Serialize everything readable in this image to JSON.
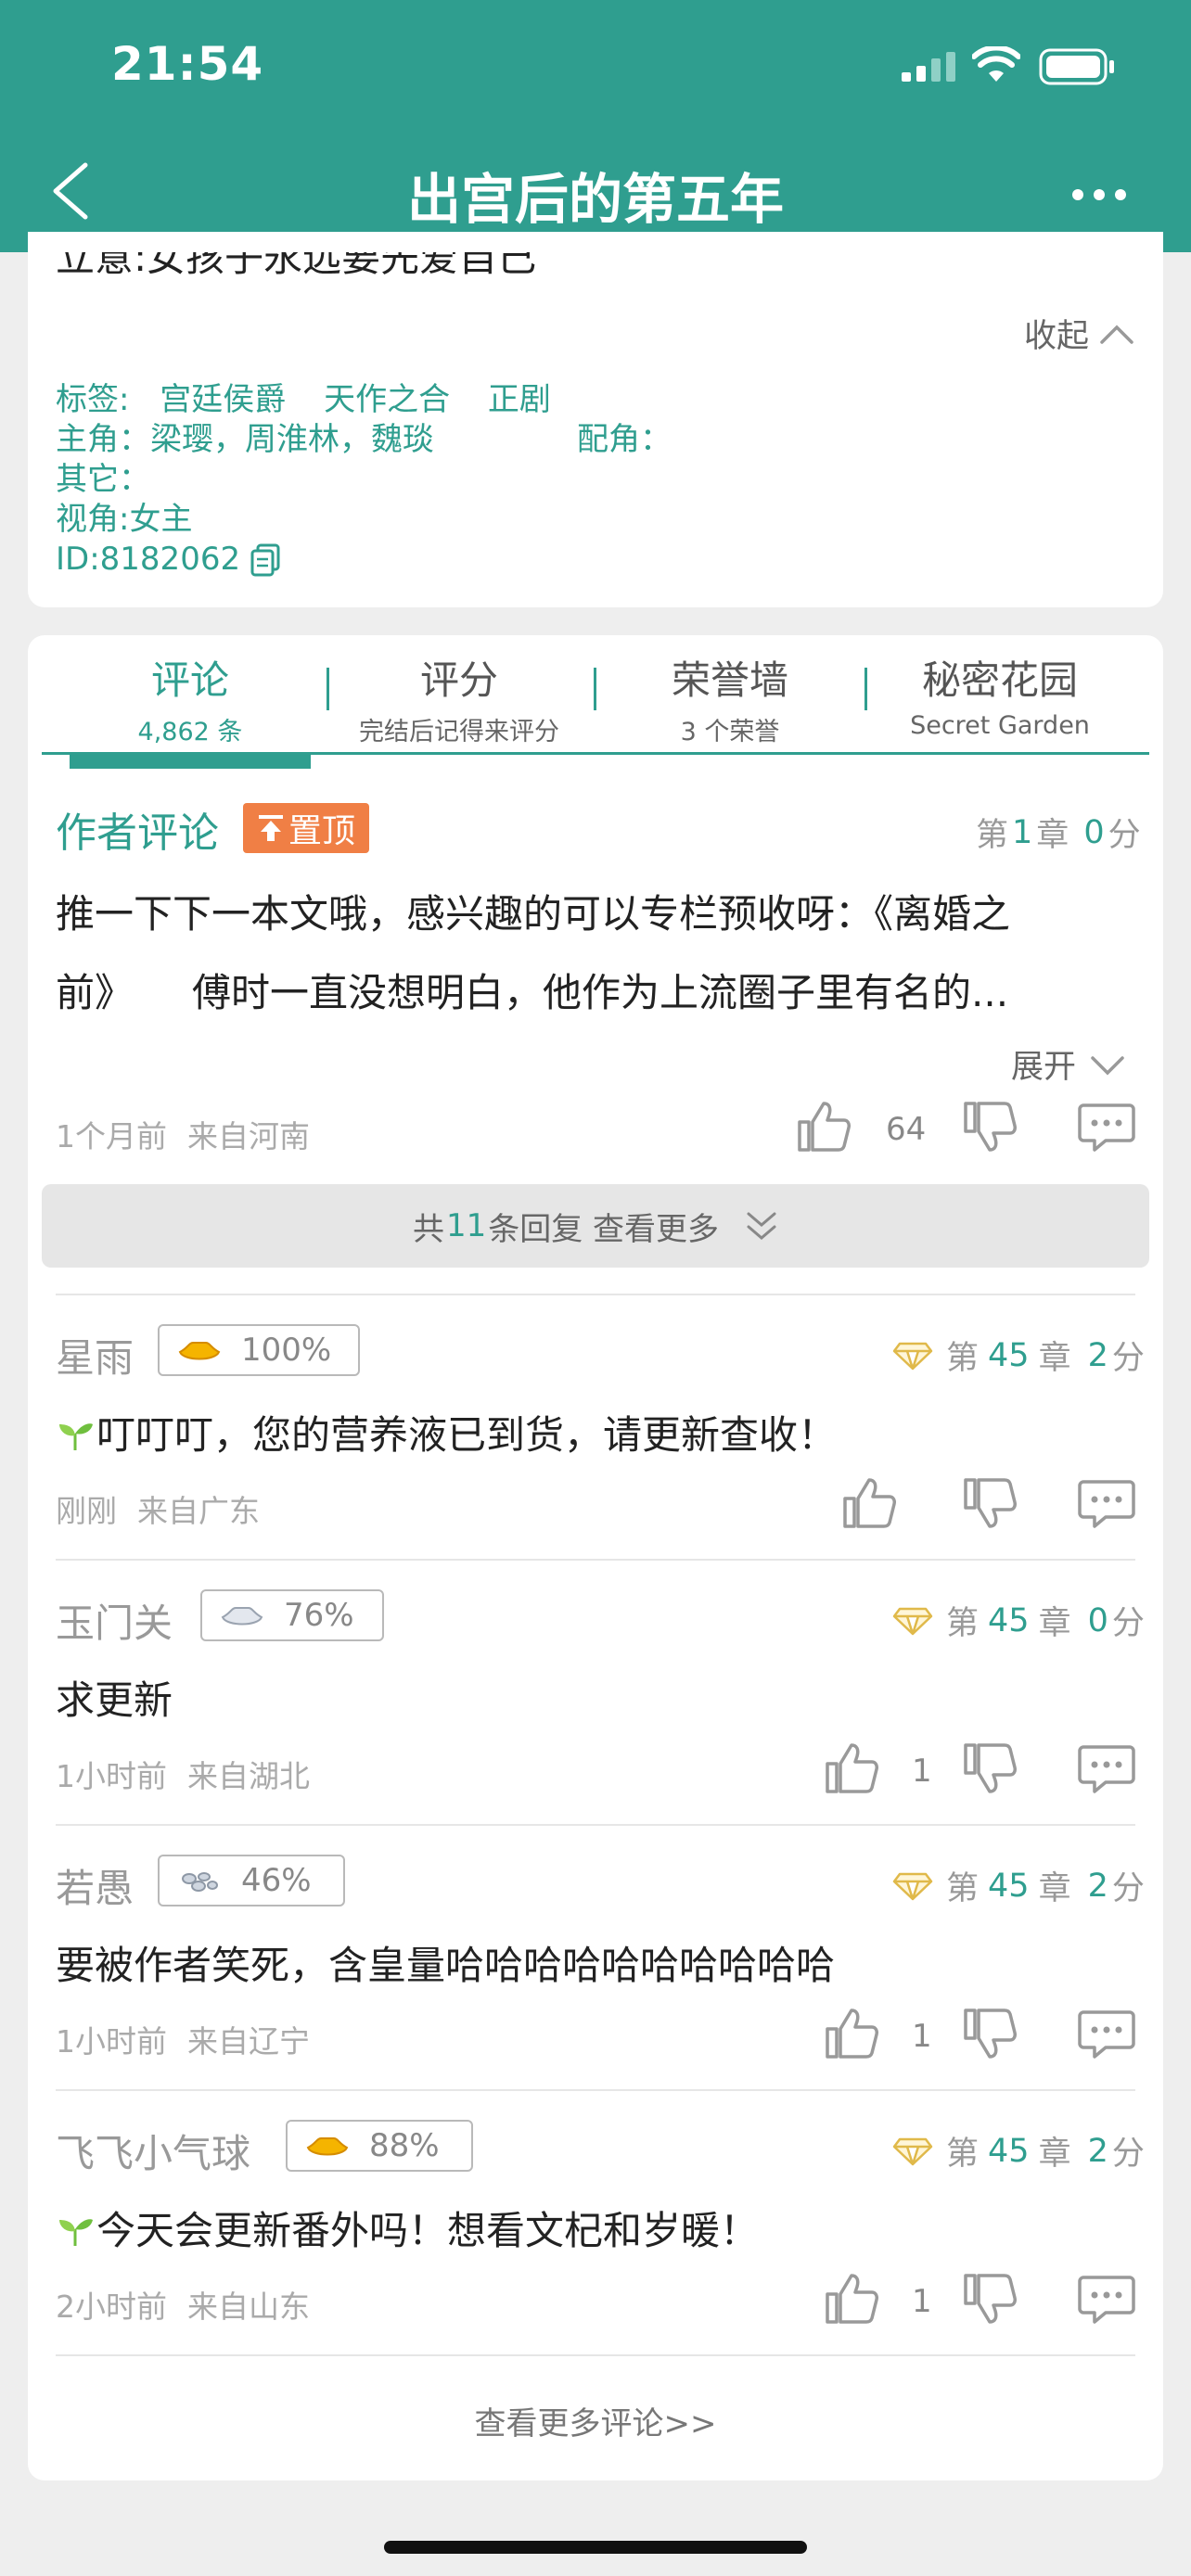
{
  "status_bar": {
    "time": "21:54"
  },
  "nav": {
    "title": "出宫后的第五年"
  },
  "info": {
    "partial_line": "立意:女孩子永远要先爱自己",
    "collapse_label": "收起",
    "tags_label": "标签:",
    "tags": [
      "宫廷侯爵",
      "天作之合",
      "正剧"
    ],
    "leads": "主角：梁璎，周淮林，魏琰",
    "supporting": "配角：",
    "others": "其它：",
    "perspective": "视角:女主",
    "id": "ID:8182062"
  },
  "tabs": [
    {
      "label": "评论",
      "sub": "4,862 条"
    },
    {
      "label": "评分",
      "sub": "完结后记得来评分"
    },
    {
      "label": "荣誉墙",
      "sub": "3 个荣誉"
    },
    {
      "label": "秘密花园",
      "sub": "Secret Garden"
    }
  ],
  "author_comment": {
    "title": "作者评论",
    "pin_label": "置顶",
    "chapter_prefix": "第",
    "chapter": "1",
    "chapter_suffix": "章",
    "score": "0",
    "score_unit": "分",
    "line1": "推一下下一本文哦，感兴趣的可以专栏预收呀：《离婚之",
    "line2": "前》　　傅时一直没想明白，他作为上流圈子里有名的...",
    "expand_label": "展开",
    "time": "1个月前",
    "location": "来自河南",
    "likes": "64",
    "replies_prefix": "共",
    "replies_count": "11",
    "replies_suffix": "条回复 查看更多"
  },
  "comments": [
    {
      "name": "星雨",
      "pct": "100%",
      "chapter": "45",
      "score": "2",
      "text": "叮叮叮，您的营养液已到货，请更新查收！",
      "time": "刚刚",
      "location": "来自广东",
      "likes": ""
    },
    {
      "name": "玉门关",
      "pct": "76%",
      "chapter": "45",
      "score": "0",
      "text": "求更新",
      "time": "1小时前",
      "location": "来自湖北",
      "likes": "1"
    },
    {
      "name": "若愚",
      "pct": "46%",
      "chapter": "45",
      "score": "2",
      "text": "要被作者笑死，含皇量哈哈哈哈哈哈哈哈哈哈",
      "time": "1小时前",
      "location": "来自辽宁",
      "likes": "1"
    },
    {
      "name": "飞飞小气球",
      "pct": "88%",
      "chapter": "45",
      "score": "2",
      "text": "今天会更新番外吗！想看文杞和岁暖！",
      "time": "2小时前",
      "location": "来自山东",
      "likes": "1"
    }
  ],
  "labels": {
    "chapter_prefix": "第",
    "chapter_suffix": "章",
    "score_unit": "分",
    "more_comments": "查看更多评论>>"
  }
}
